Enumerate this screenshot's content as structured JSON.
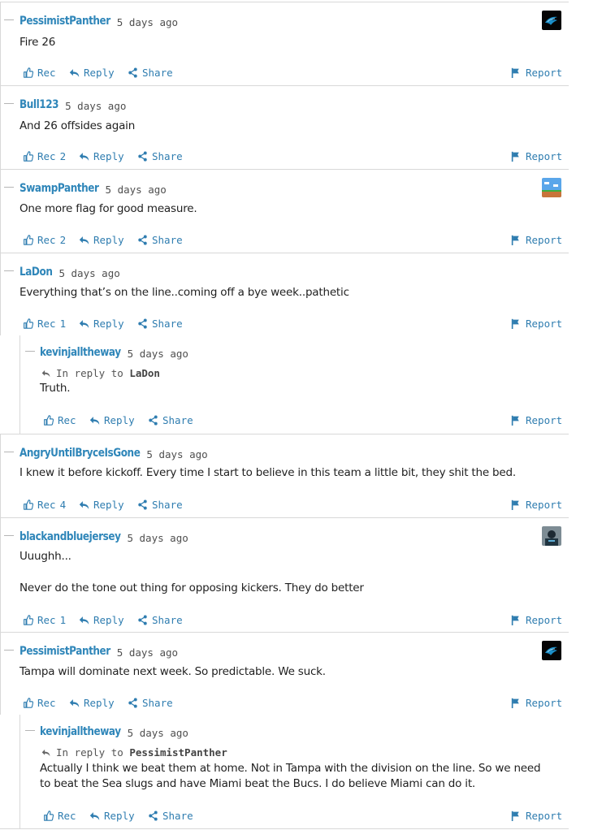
{
  "labels": {
    "rec": "Rec",
    "reply": "Reply",
    "share": "Share",
    "report": "Report",
    "in_reply_to": "In reply to"
  },
  "comments": [
    {
      "user": "PessimistPanther",
      "time": "5 days ago",
      "body": "Fire 26",
      "rec_count": "",
      "avatar": "panther-logo"
    },
    {
      "user": "Bull123",
      "time": "5 days ago",
      "body": "And 26 offsides again",
      "rec_count": "2",
      "avatar": ""
    },
    {
      "user": "SwampPanther",
      "time": "5 days ago",
      "body": "One more flag for good measure.",
      "rec_count": "2",
      "avatar": "pixel-landscape"
    },
    {
      "user": "LaDon",
      "time": "5 days ago",
      "body": "Everything that’s on the line..coming off a bye week..pathetic",
      "rec_count": "1",
      "avatar": ""
    },
    {
      "user": "kevinjalltheway",
      "time": "5 days ago",
      "in_reply_to": "LaDon",
      "body": "Truth.",
      "rec_count": "",
      "avatar": ""
    },
    {
      "user": "AngryUntilBryceIsGone",
      "time": "5 days ago",
      "body": "I knew it before kickoff. Every time I start to believe in this team a little bit, they shit the bed.",
      "rec_count": "4",
      "avatar": ""
    },
    {
      "user": "blackandbluejersey",
      "time": "5 days ago",
      "body": "Uuughh...",
      "body2": "Never do the tone out thing for opposing kickers. They do better",
      "rec_count": "1",
      "avatar": "player-photo"
    },
    {
      "user": "PessimistPanther",
      "time": "5 days ago",
      "body": "Tampa will dominate next week. So predictable. We suck.",
      "rec_count": "",
      "avatar": "panther-logo"
    },
    {
      "user": "kevinjalltheway",
      "time": "5 days ago",
      "in_reply_to": "PessimistPanther",
      "body": "Actually I think we beat them at home. Not in Tampa with the division on the line. So we need to beat the Sea slugs and have Miami beat the Bucs. I do believe Miami can do it.",
      "rec_count": "",
      "avatar": ""
    }
  ],
  "colors": {
    "link": "#2f7db0",
    "username": "#2f86b9",
    "border": "#d8d8d8"
  }
}
